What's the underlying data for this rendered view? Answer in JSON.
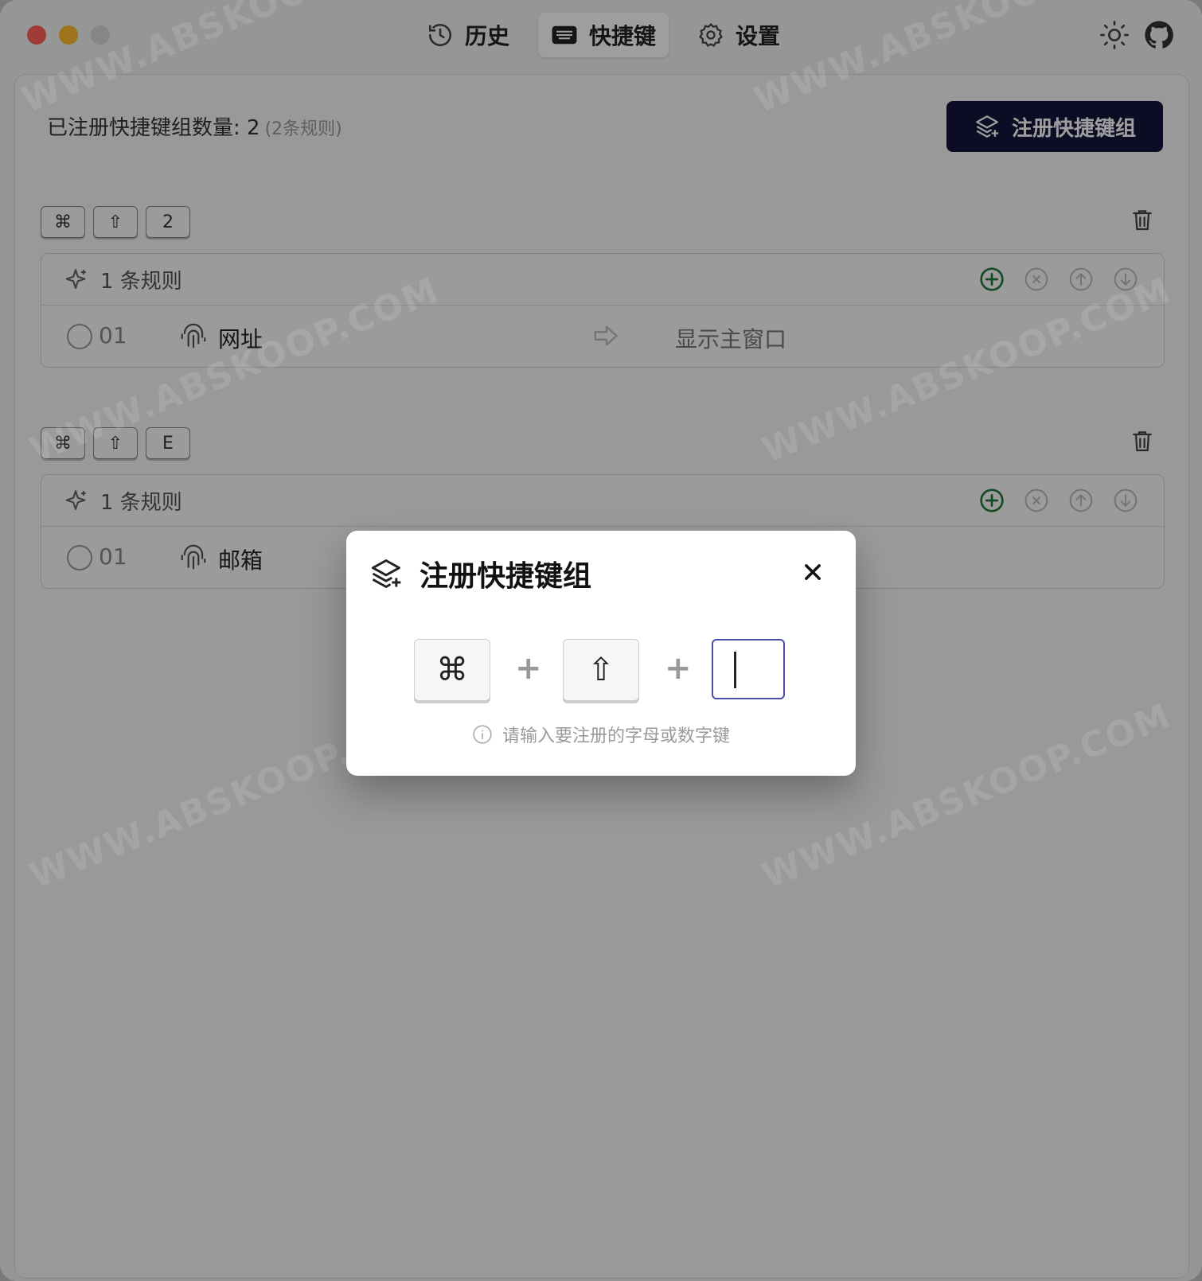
{
  "tabs": [
    {
      "label": "历史",
      "icon": "history-icon",
      "active": false
    },
    {
      "label": "快捷键",
      "icon": "keyboard-icon",
      "active": true
    },
    {
      "label": "设置",
      "icon": "gear-icon",
      "active": false
    }
  ],
  "summary": {
    "label": "已注册快捷键组数量: 2",
    "sub": "(2条规则)"
  },
  "register_button": {
    "label": "注册快捷键组",
    "icon": "layers-plus-icon"
  },
  "groups": [
    {
      "keys": [
        "⌘",
        "⇧",
        "2"
      ],
      "rules_label": "1 条规则",
      "rules": [
        {
          "index": "01",
          "name": "网址",
          "target": "显示主窗口"
        }
      ]
    },
    {
      "keys": [
        "⌘",
        "⇧",
        "E"
      ],
      "rules_label": "1 条规则",
      "rules": [
        {
          "index": "01",
          "name": "邮箱",
          "target": ""
        }
      ]
    }
  ],
  "dialog": {
    "title": "注册快捷键组",
    "key1": "⌘",
    "key2": "⇧",
    "plus": "+",
    "input_value": "",
    "hint": "请输入要注册的字母或数字键"
  },
  "watermark": "WWW.ABSKOOP.COM",
  "colors": {
    "accent": "#14163b",
    "add_green": "#1e7a3a",
    "input_border": "#4b4fa8"
  }
}
